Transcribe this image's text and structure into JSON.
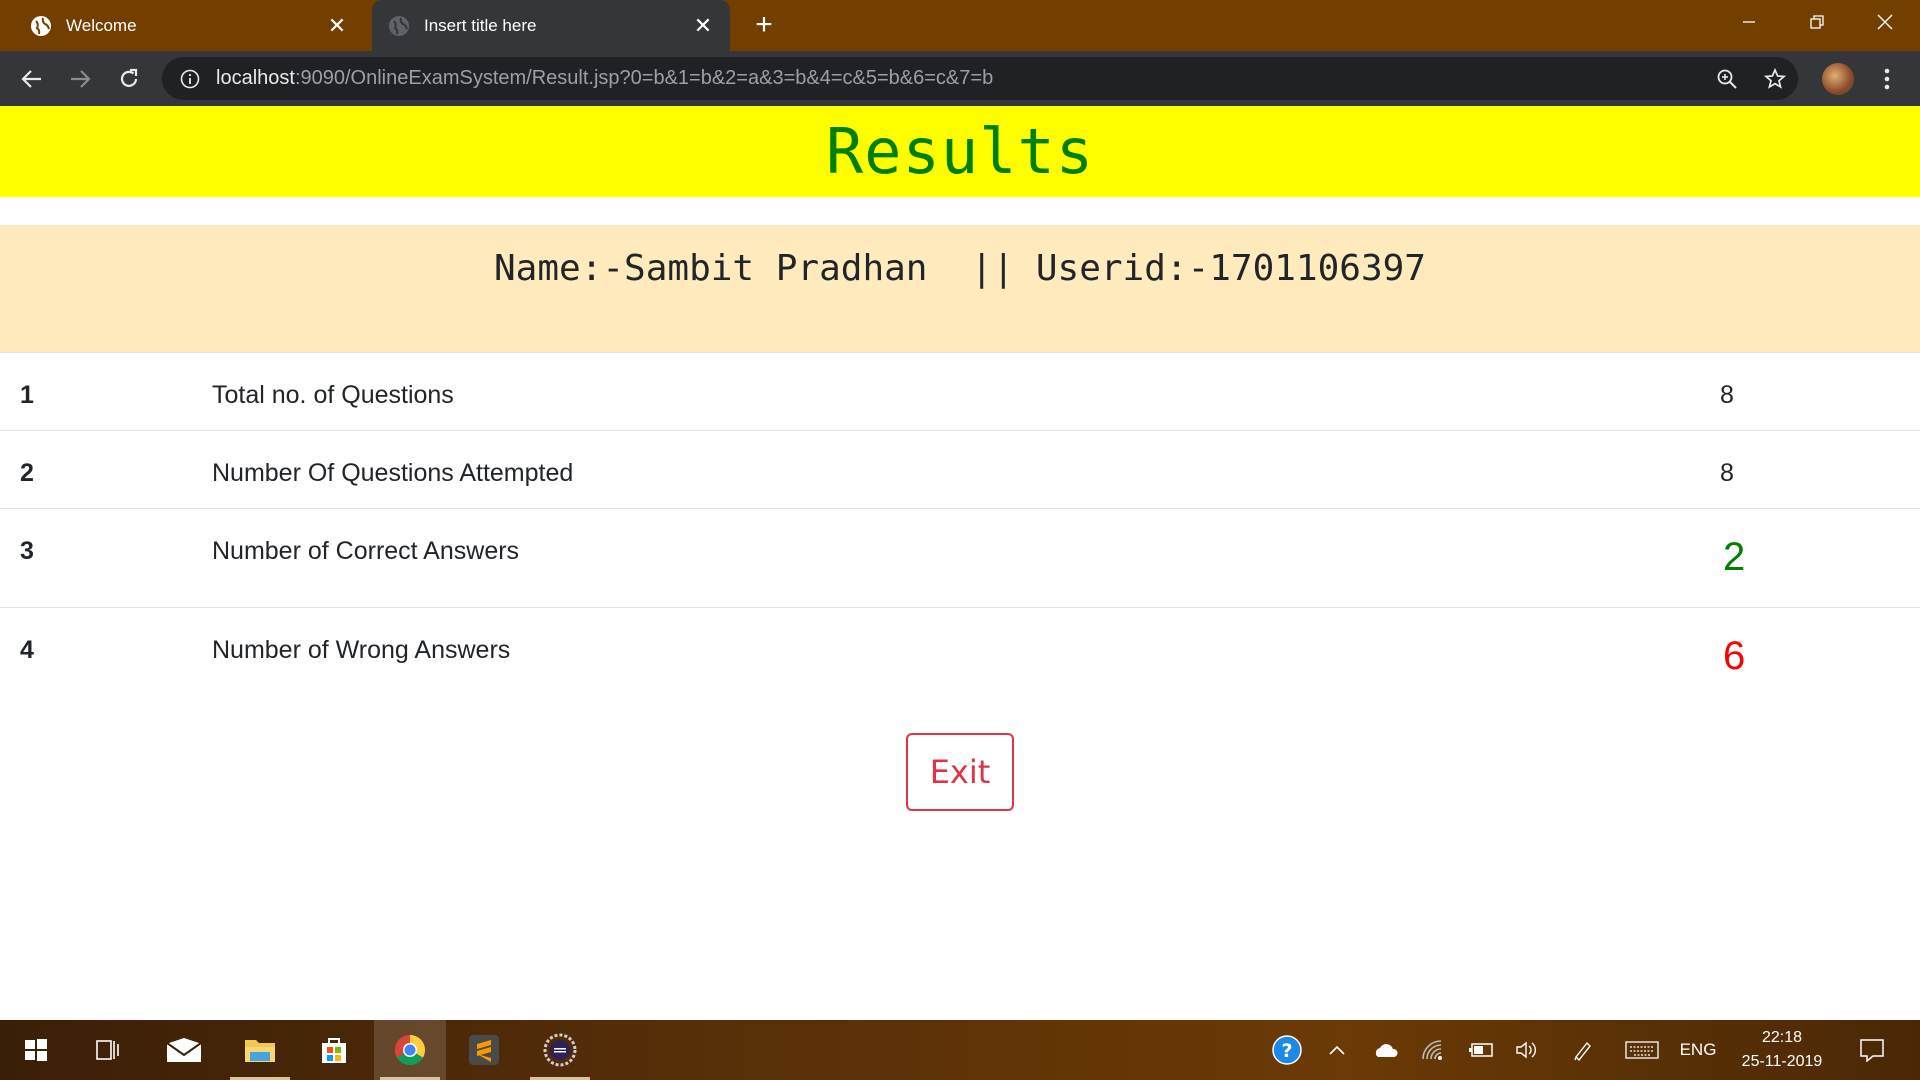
{
  "browser": {
    "tabs": [
      {
        "title": "Welcome",
        "icon": "globe-icon",
        "active": false
      },
      {
        "title": "Insert title here",
        "icon": "globe-icon",
        "active": true
      }
    ],
    "url_host": "localhost",
    "url_rest": ":9090/OnlineExamSystem/Result.jsp?0=b&1=b&2=a&3=b&4=c&5=b&6=c&7=b"
  },
  "page": {
    "heading": "Results",
    "user_info": "Name:-Sambit Pradhan  || Userid:-1701106397",
    "rows": [
      {
        "num": "1",
        "label": "Total no. of Questions",
        "value": "8"
      },
      {
        "num": "2",
        "label": "Number Of Questions Attempted",
        "value": "8"
      },
      {
        "num": "3",
        "label": "Number of Correct Answers",
        "value": "2"
      },
      {
        "num": "4",
        "label": "Number of Wrong Answers",
        "value": "6"
      }
    ],
    "exit_label": "Exit",
    "colors": {
      "banner": "#ffff00",
      "heading": "#008000",
      "user_strip": "#ffebbd",
      "correct": "#008000",
      "wrong": "#ff0000",
      "exit": "#dc3545"
    }
  },
  "taskbar": {
    "apps": [
      "windows-start-icon",
      "task-view-icon",
      "mail-icon",
      "file-explorer-icon",
      "store-icon",
      "chrome-icon",
      "sublime-text-icon",
      "eclipse-icon"
    ],
    "tray": [
      "help-icon",
      "chevron-up-icon",
      "onedrive-icon",
      "wifi-icon",
      "battery-icon",
      "volume-icon",
      "pen-icon",
      "keyboard-icon"
    ],
    "language": "ENG",
    "time": "22:18",
    "date": "25-11-2019"
  }
}
